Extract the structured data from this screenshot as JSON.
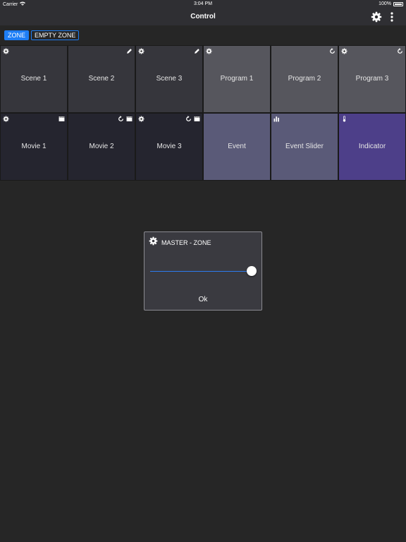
{
  "status_bar": {
    "carrier": "Carrier",
    "time": "3:04 PM",
    "battery": "100%"
  },
  "nav": {
    "title": "Control",
    "settings_icon": "gear-icon",
    "menu_icon": "more-vertical-icon"
  },
  "zones": [
    {
      "label": "ZONE",
      "active": true
    },
    {
      "label": "EMPTY ZONE",
      "active": false
    }
  ],
  "tiles": [
    {
      "label": "Scene 1",
      "bg": "#36363c",
      "icons_left": [
        "gear"
      ],
      "icons_right": []
    },
    {
      "label": "Scene 2",
      "bg": "#36363c",
      "icons_left": [],
      "icons_right": [
        "pencil"
      ]
    },
    {
      "label": "Scene 3",
      "bg": "#36363c",
      "icons_left": [
        "gear"
      ],
      "icons_right": [
        "pencil"
      ]
    },
    {
      "label": "Program 1",
      "bg": "#56565d",
      "icons_left": [
        "gear"
      ],
      "icons_right": []
    },
    {
      "label": "Program 2",
      "bg": "#56565d",
      "icons_left": [],
      "icons_right": [
        "refresh"
      ]
    },
    {
      "label": "Program 3",
      "bg": "#56565d",
      "icons_left": [
        "gear"
      ],
      "icons_right": [
        "refresh"
      ]
    },
    {
      "label": "Movie 1",
      "bg": "#25252f",
      "icons_left": [
        "gear"
      ],
      "icons_right": [
        "clapper"
      ]
    },
    {
      "label": "Movie 2",
      "bg": "#25252f",
      "icons_left": [],
      "icons_right": [
        "refresh",
        "clapper"
      ]
    },
    {
      "label": "Movie 3",
      "bg": "#25252f",
      "icons_left": [
        "gear"
      ],
      "icons_right": [
        "refresh",
        "clapper"
      ]
    },
    {
      "label": "Event",
      "bg": "#5a5a78",
      "icons_left": [],
      "icons_right": []
    },
    {
      "label": "Event Slider",
      "bg": "#5a5a78",
      "icons_left": [
        "bar-chart"
      ],
      "icons_right": []
    },
    {
      "label": "Indicator",
      "bg": "#4d3f89",
      "icons_left": [
        "thermometer"
      ],
      "icons_right": []
    }
  ],
  "dialog": {
    "title": "MASTER - ZONE",
    "icon": "gear-icon",
    "slider_value": 1.0,
    "ok_label": "Ok"
  },
  "colors": {
    "accent": "#1e7ef5",
    "background": "#262626",
    "bar": "#2f2f33"
  }
}
